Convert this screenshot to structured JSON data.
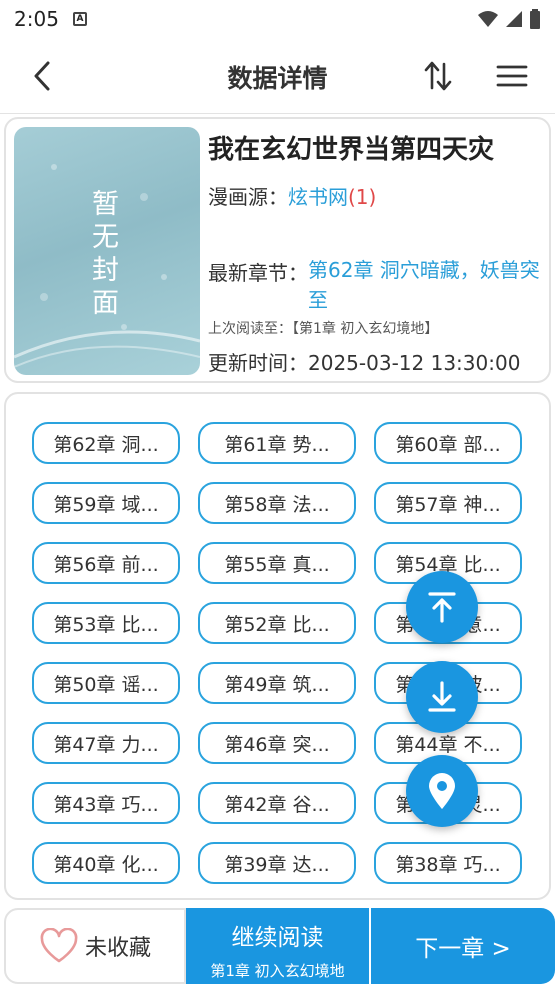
{
  "status_bar": {
    "time": "2:05",
    "sim_badge": "A"
  },
  "app_bar": {
    "title": "数据详情"
  },
  "book": {
    "cover_text": "暂无封面",
    "title": "我在玄幻世界当第四天灾",
    "source_label": "漫画源：",
    "source_name": "炫书网",
    "source_count": "(1)",
    "latest_label": "最新章节：",
    "latest_chapter": "第62章 洞穴暗藏，妖兽突至",
    "last_read_label": "上次阅读至：",
    "last_read_value": "【第1章 初入玄幻境地】",
    "update_label": "更新时间：",
    "update_time": "2025-03-12 13:30:00"
  },
  "chapters": [
    "第62章 洞...",
    "第61章 势...",
    "第60章 部...",
    "第59章 域...",
    "第58章 法...",
    "第57章 神...",
    "第56章 前...",
    "第55章 真...",
    "第54章 比...",
    "第53章 比...",
    "第52章 比...",
    "第51章 意...",
    "第50章 谣...",
    "第49章 筑...",
    "第48章 波...",
    "第47章 力...",
    "第46章 突...",
    "第44章 不...",
    "第43章 巧...",
    "第42章 谷...",
    "第41章 灵...",
    "第40章 化...",
    "第39章 达...",
    "第38章 巧..."
  ],
  "bottom_bar": {
    "favorite_label": "未收藏",
    "continue_label": "继续阅读",
    "continue_sub": "第1章 初入玄幻境地",
    "next_label": "下一章 >"
  },
  "colors": {
    "accent": "#1a96e0",
    "link": "#2a9ed8",
    "count": "#e04848"
  }
}
